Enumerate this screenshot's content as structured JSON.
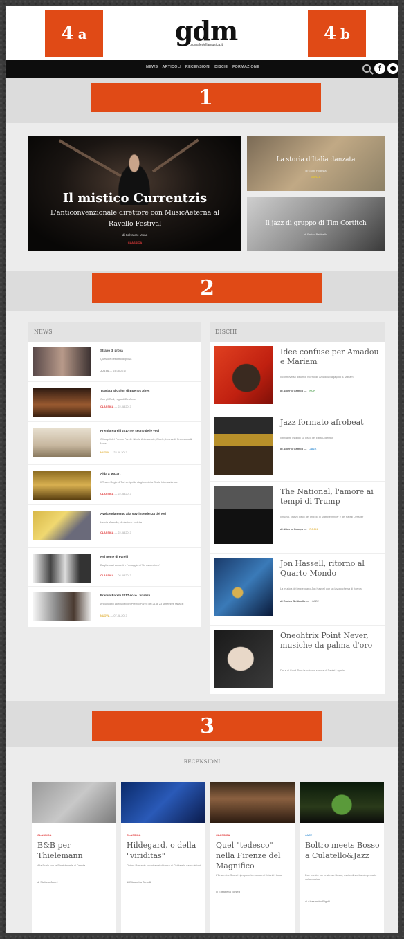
{
  "header": {
    "logo": "gdm",
    "logo_sub": "giornaledellamusica.it",
    "tag_4a": "4",
    "tag_4a_sfx": "a",
    "tag_4b": "4",
    "tag_4b_sfx": "b"
  },
  "nav": {
    "items": [
      "NEWS",
      "ARTICOLI",
      "RECENSIONI",
      "DISCHI",
      "FORMAZIONE"
    ],
    "icons": [
      "search-icon",
      "facebook-icon",
      "twitter-icon"
    ]
  },
  "sections": {
    "tag_1": "1",
    "tag_2": "2",
    "tag_3": "3"
  },
  "hero": {
    "main": {
      "title": "Il mistico Currentzis",
      "subtitle": "L'anticonvenzionale direttore con MusicAeterna al Ravello Festival",
      "author": "di Salvatore Mona",
      "category": "CLASSICA"
    },
    "side": [
      {
        "title": "La storia d'Italia danzata",
        "author": "di Giulio Podestà",
        "category": "DANZA"
      },
      {
        "title": "Il jazz di gruppo di Tim Cortitch",
        "author": "di Enrico Bettinello",
        "category": "JAZZ"
      }
    ]
  },
  "news": {
    "heading": "NEWS",
    "items": [
      {
        "title": "Stravo di prova",
        "desc": "Questo è descritto di prova",
        "category": "JUSTA",
        "date": "14-08-2017",
        "cat_color": "#999999"
      },
      {
        "title": "Traviata al Colon di Buenos Aires",
        "desc": "Con gli Rolli, regia di DeMonte",
        "category": "CLASSICA",
        "date": "22-08-2017",
        "cat_color": "#e03a3a"
      },
      {
        "title": "Premio Parelli 2017 nel segno delle voci",
        "desc": "Gli ospiti del Premio Parelli: Nicola Abbracciate, Gioele, Leonardi, Francesca & More",
        "category": "NUOVA",
        "date": "22-08-2017",
        "cat_color": "#e0b13a"
      },
      {
        "title": "Aida a Mozart",
        "desc": "Il Teatro Regio di Torino: ipni la stagione della Scala Internazionale",
        "category": "CLASSICA",
        "date": "22-08-2017",
        "cat_color": "#e03a3a"
      },
      {
        "title": "Avvicendamento alla sovrintendenza del Nel",
        "desc": "Lascia Marcello, dimissione vedetta",
        "category": "CLASSICA",
        "date": "22-08-2017",
        "cat_color": "#e03a3a"
      },
      {
        "title": "Nel nome di Parelli",
        "desc": "Dagli e stati concerti e l'omaggio di 'Un ascenzione'",
        "category": "CLASSICA",
        "date": "08-08-2017",
        "cat_color": "#e03a3a"
      },
      {
        "title": "Premio Parelli 2017 ecco i finalisti",
        "desc": "Annunciati i 18 finalisti del Premio Parelli del 21 al 23 settembre ragazzi",
        "category": "NUOVA",
        "date": "07-08-2017",
        "cat_color": "#e0b13a"
      }
    ]
  },
  "dischi": {
    "heading": "DISCHI",
    "items": [
      {
        "title": "Idee confuse per Amadou e Mariam",
        "desc": "Il controverso album di ritorno de Amadou Bagayoko & Mariam",
        "author": "di Alberto Campo",
        "genre": "POP",
        "genre_color": "#5aa55a"
      },
      {
        "title": "Jazz formato afrobeat",
        "desc": "Il brillante esordio su disco dei Ezra Collective",
        "author": "di Alberto Campo",
        "genre": "JAZZ",
        "genre_color": "#4a9ad8"
      },
      {
        "title": "The National, l'amore ai tempi di Trump",
        "desc": "Il nuovo, ottavo disco del gruppo di Matt Berninger e dei fratelli Dessner",
        "author": "di Alberto Campo",
        "genre": "ROCK",
        "genre_color": "#e0b13a"
      },
      {
        "title": "Jon Hassell, ritorno al Quarto Mondo",
        "desc": "La musica del leggendario Jon Hassell con un lavoro che sa di ricerca",
        "author": "di Enrico Bettinello",
        "genre": "JAZZ",
        "genre_color": "#999999"
      },
      {
        "title": "Oneohtrix Point Never, musiche da palma d'oro",
        "desc": "Dal e ai Good Time la colonna sonora di Daniel Lopatin",
        "author": "",
        "genre": "",
        "genre_color": "#999999"
      }
    ]
  },
  "recensioni": {
    "heading": "RECENSIONI",
    "items": [
      {
        "category": "CLASSICA",
        "cat_color": "#e03a3a",
        "title": "B&B per Thielemann",
        "desc": "Alla Scala con la Staatskapelle di Dresda",
        "author": "di Stefano Jacini"
      },
      {
        "category": "CLASSICA",
        "cat_color": "#e03a3a",
        "title": "Hildegard, o della \"viriditas\"",
        "desc": "Ordine Romanie incontra nel chiostro di Cividale le sacre visioni",
        "author": "di Elisabetta Torselli"
      },
      {
        "category": "CLASSICA",
        "cat_color": "#e03a3a",
        "title": "Quel \"tedesco\" nella Firenze del Magnifico",
        "desc": "L'Ensemble Scabel ripropone la musica di Heinrich Isaac",
        "author": "di Elisabetta Torselli"
      },
      {
        "category": "JAZZ",
        "cat_color": "#4a9ad8",
        "title": "Boltro meets Bosso a Culatello&Jazz",
        "desc": "Due trombe per lo stesso Bosso, ospite di spettacolo pensato sulla musica",
        "author": "di Alessandro Rigolli"
      }
    ]
  }
}
